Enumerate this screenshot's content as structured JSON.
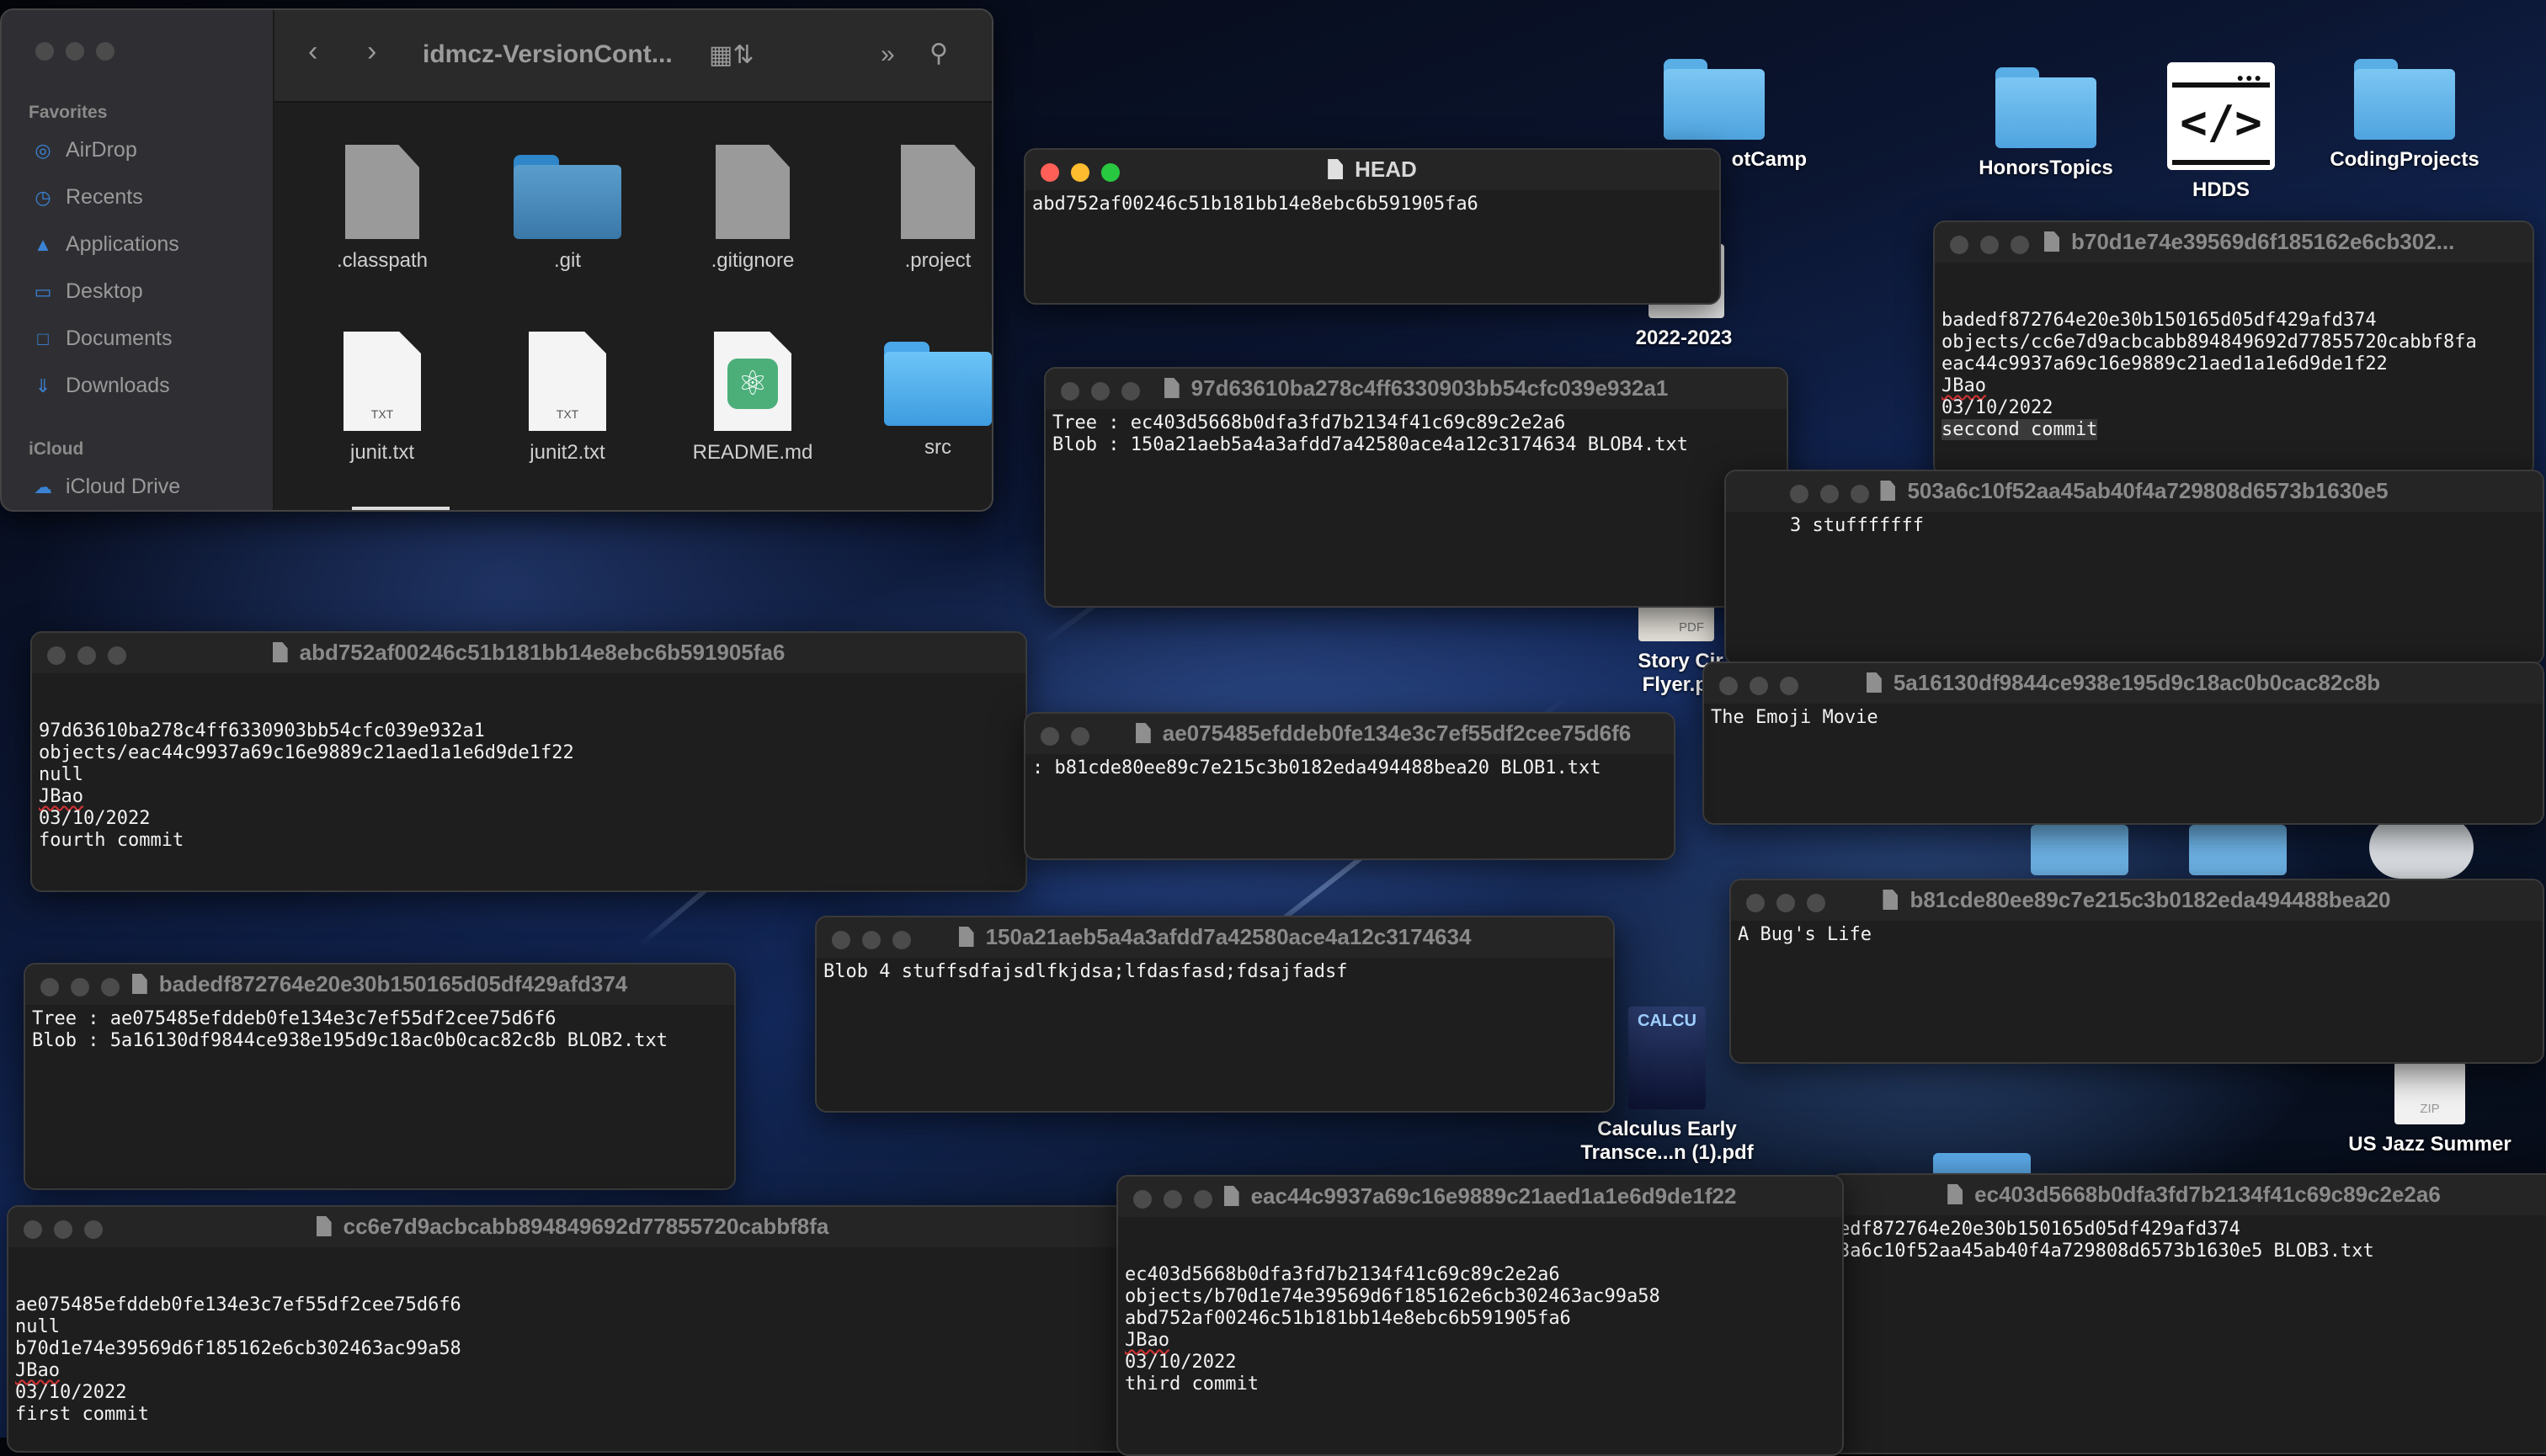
{
  "finder": {
    "path_title": "idmcz-VersionCont...",
    "sidebar": {
      "favorites_heading": "Favorites",
      "favorites": [
        {
          "label": "AirDrop",
          "icon": "airdrop-icon"
        },
        {
          "label": "Recents",
          "icon": "clock-icon"
        },
        {
          "label": "Applications",
          "icon": "applications-icon"
        },
        {
          "label": "Desktop",
          "icon": "desktop-icon"
        },
        {
          "label": "Documents",
          "icon": "document-icon"
        },
        {
          "label": "Downloads",
          "icon": "download-icon"
        }
      ],
      "icloud_heading": "iCloud",
      "icloud": [
        {
          "label": "iCloud Drive",
          "icon": "cloud-icon"
        }
      ]
    },
    "files": [
      {
        "label": ".classpath",
        "kind": "generic"
      },
      {
        "label": ".git",
        "kind": "folder"
      },
      {
        "label": ".gitignore",
        "kind": "generic"
      },
      {
        "label": ".project",
        "kind": "generic"
      },
      {
        "label": "junit.txt",
        "kind": "txt",
        "ext": "TXT"
      },
      {
        "label": "junit2.txt",
        "kind": "txt",
        "ext": "TXT"
      },
      {
        "label": "README.md",
        "kind": "md"
      },
      {
        "label": "src",
        "kind": "folder"
      }
    ]
  },
  "desktop_icons": [
    {
      "label": "otCamp"
    },
    {
      "label": "HonorsTopics"
    },
    {
      "label": "HDDS",
      "glyph": "</>"
    },
    {
      "label": "CodingProjects"
    },
    {
      "label": "2022-2023"
    },
    {
      "label": "Story Cir",
      "label2": "Flyer.pc",
      "badge": "PDF"
    },
    {
      "label": "Calculus Early",
      "label2": "Transce...n (1).pdf",
      "cover_text": "CALCU"
    },
    {
      "label": "US Jazz Summer",
      "badge": "ZIP"
    }
  ],
  "windows": {
    "head": {
      "title": "HEAD",
      "lines": [
        "abd752af00246c51b181bb14e8ebc6b591905fa6"
      ]
    },
    "w97d": {
      "title": "97d63610ba278c4ff6330903bb54cfc039e932a1",
      "lines": [
        "Tree : ec403d5668b0dfa3fd7b2134f41c69c89c2e2a6",
        "Blob : 150a21aeb5a4a3afdd7a42580ace4a12c3174634 BLOB4.txt"
      ]
    },
    "wb70": {
      "title": "b70d1e74e39569d6f185162e6cb302...",
      "lines": [
        "badedf872764e20e30b150165d05df429afd374",
        "objects/cc6e7d9acbcabb894849692d77855720cabbf8fa",
        "eac44c9937a69c16e9889c21aed1a1e6d9de1f22",
        "JBao",
        "03/10/2022",
        "seccond commit"
      ]
    },
    "w503": {
      "title": "503a6c10f52aa45ab40f4a729808d6573b1630e5",
      "lines": [
        "3 stufffffff"
      ]
    },
    "w5a1": {
      "title": "5a16130df9844ce938e195d9c18ac0b0cac82c8b",
      "lines": [
        "The Emoji Movie"
      ]
    },
    "wabd": {
      "title": "abd752af00246c51b181bb14e8ebc6b591905fa6",
      "lines": [
        "97d63610ba278c4ff6330903bb54cfc039e932a1",
        "objects/eac44c9937a69c16e9889c21aed1a1e6d9de1f22",
        "null",
        "JBao",
        "03/10/2022",
        "fourth commit"
      ]
    },
    "wae0": {
      "title": "ae075485efddeb0fe134e3c7ef55df2cee75d6f6",
      "lines": [
        ": b81cde80ee89c7e215c3b0182eda494488bea20 BLOB1.txt"
      ]
    },
    "wb81": {
      "title": "b81cde80ee89c7e215c3b0182eda494488bea20",
      "lines": [
        "A Bug's Life"
      ]
    },
    "w150": {
      "title": "150a21aeb5a4a3afdd7a42580ace4a12c3174634",
      "lines": [
        "Blob 4 stuffsdfajsdlfkjdsa;lfdasfasd;fdsajfadsf"
      ]
    },
    "wbad": {
      "title": "badedf872764e20e30b150165d05df429afd374",
      "lines": [
        "Tree : ae075485efddeb0fe134e3c7ef55df2cee75d6f6",
        "Blob : 5a16130df9844ce938e195d9c18ac0b0cac82c8b BLOB2.txt"
      ]
    },
    "wcc6": {
      "title": "cc6e7d9acbcabb894849692d77855720cabbf8fa",
      "lines": [
        "ae075485efddeb0fe134e3c7ef55df2cee75d6f6",
        "null",
        "b70d1e74e39569d6f185162e6cb302463ac99a58",
        "JBao",
        "03/10/2022",
        "first commit"
      ]
    },
    "weac": {
      "title": "eac44c9937a69c16e9889c21aed1a1e6d9de1f22",
      "lines": [
        "ec403d5668b0dfa3fd7b2134f41c69c89c2e2a6",
        "objects/b70d1e74e39569d6f185162e6cb302463ac99a58",
        "abd752af00246c51b181bb14e8ebc6b591905fa6",
        "JBao",
        "03/10/2022",
        "third commit"
      ]
    },
    "wec4": {
      "title": "ec403d5668b0dfa3fd7b2134f41c69c89c2e2a6",
      "lines": [
        "edf872764e20e30b150165d05df429afd374",
        "3a6c10f52aa45ab40f4a729808d6573b1630e5 BLOB3.txt"
      ]
    }
  }
}
